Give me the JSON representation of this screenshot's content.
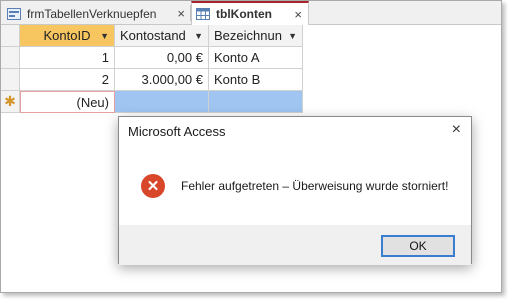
{
  "tabs": [
    {
      "label": "frmTabellenVerknuepfen",
      "icon": "form-icon",
      "active": false
    },
    {
      "label": "tblKonten",
      "icon": "table-icon",
      "active": true
    }
  ],
  "tab_close_symbol": "×",
  "table": {
    "columns": [
      "KontoID",
      "Kontostand",
      "Bezeichnun"
    ],
    "rows": [
      {
        "id": "1",
        "kontostand": "0,00 €",
        "bezeichnung": "Konto A"
      },
      {
        "id": "2",
        "kontostand": "3.000,00 €",
        "bezeichnung": "Konto B"
      }
    ],
    "new_row_marker": "✱",
    "new_row_label": "(Neu)"
  },
  "dialog": {
    "title": "Microsoft Access",
    "close_symbol": "×",
    "icon": "error-icon",
    "icon_glyph": "✕",
    "message": "Fehler aufgetreten – Überweisung wurde storniert!",
    "ok_label": "OK"
  },
  "colors": {
    "active_header": "#f7c660",
    "new_row_highlight": "#9fc5f0",
    "error_icon": "#d9472b",
    "ok_focus_border": "#3b7ed1"
  }
}
